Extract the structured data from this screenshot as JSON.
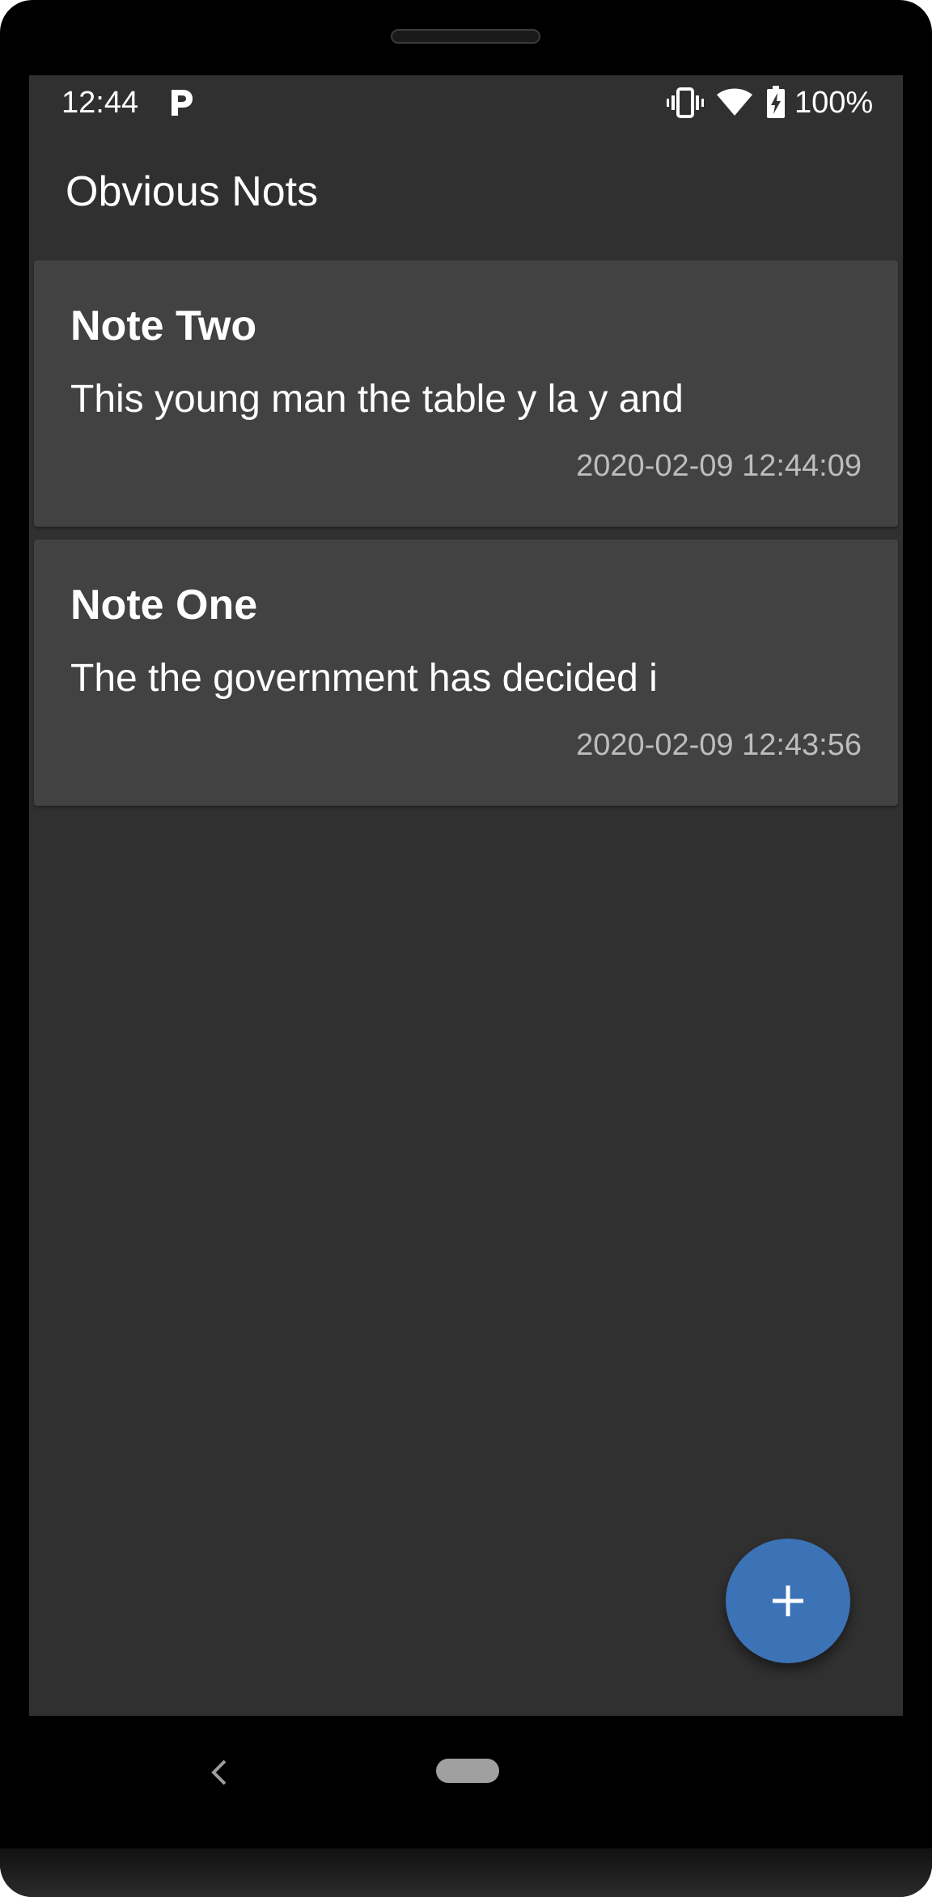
{
  "status_bar": {
    "time": "12:44",
    "battery": "100%",
    "icons": [
      "parking-icon",
      "vibrate-icon",
      "wifi-icon",
      "battery-charging-icon"
    ]
  },
  "app_bar": {
    "title": "Obvious Nots"
  },
  "notes": [
    {
      "title": "Note Two",
      "body": "This young man the table y la y and",
      "date": "2020-02-09 12:44:09"
    },
    {
      "title": "Note One",
      "body": "The the government has decided i",
      "date": "2020-02-09 12:43:56"
    }
  ],
  "fab": {
    "icon": "plus-icon",
    "color": "#3c73b6"
  },
  "nav_bar": {
    "icons": [
      "back-icon",
      "home-pill"
    ]
  },
  "theme": {
    "background": "#303030",
    "card": "#424242",
    "accent": "#3c73b6"
  }
}
